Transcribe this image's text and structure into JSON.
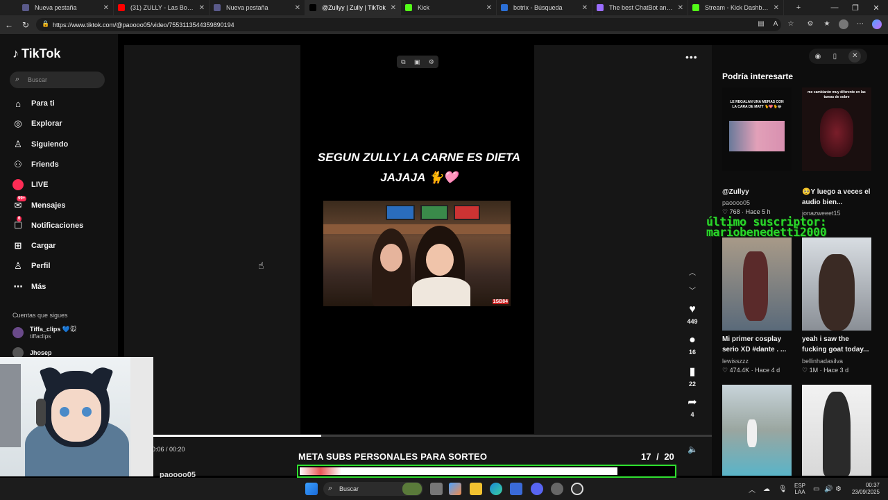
{
  "browser": {
    "tabs": [
      {
        "label": "Nueva pestaña",
        "color": "#5a5a8a",
        "active": false
      },
      {
        "label": "(31) ZULLY - Las Bonitas co",
        "color": "#ff0000",
        "active": false
      },
      {
        "label": "Nueva pestaña",
        "color": "#5a5a8a",
        "active": false
      },
      {
        "label": "@Zullyy | Zully | TikTok",
        "color": "#000000",
        "active": true
      },
      {
        "label": "Kick",
        "color": "#53fc18",
        "active": false
      },
      {
        "label": "botrix - Búsqueda",
        "color": "#2b6fd6",
        "active": false
      },
      {
        "label": "The best ChatBot and Widg",
        "color": "#9b6dff",
        "active": false
      },
      {
        "label": "Stream - Kick Dashboard",
        "color": "#53fc18",
        "active": false
      }
    ],
    "url": "https://www.tiktok.com/@paoooo05/video/7553113544359890194"
  },
  "sidebar": {
    "logo": "TikTok",
    "search_placeholder": "Buscar",
    "nav": [
      {
        "label": "Para ti",
        "icon": "home-icon",
        "glyph": "⌂"
      },
      {
        "label": "Explorar",
        "icon": "compass-icon",
        "glyph": "◎"
      },
      {
        "label": "Siguiendo",
        "icon": "person-icon",
        "glyph": "♙"
      },
      {
        "label": "Friends",
        "icon": "friends-icon",
        "glyph": "⚇"
      },
      {
        "label": "LIVE",
        "icon": "live-icon",
        "glyph": ""
      },
      {
        "label": "Mensajes",
        "icon": "message-icon",
        "glyph": "✉",
        "badge": "99+"
      },
      {
        "label": "Notificaciones",
        "icon": "inbox-icon",
        "glyph": "☐",
        "badge": "6"
      },
      {
        "label": "Cargar",
        "icon": "upload-icon",
        "glyph": "⊞"
      },
      {
        "label": "Perfil",
        "icon": "profile-icon",
        "glyph": "♙"
      },
      {
        "label": "Más",
        "icon": "more-icon",
        "glyph": "⋯"
      }
    ],
    "following_title": "Cuentas que sigues",
    "following": [
      {
        "name": "Tiffa_clips 💙🐭",
        "user": "tiffaclips"
      },
      {
        "name": "Jhosep",
        "user": ""
      }
    ]
  },
  "video": {
    "caption_line1": "SEGUN ZULLY LA CARNE ES DIETA",
    "caption_line2": "JAJAJA 🐈🩷",
    "watermark": "1SB84",
    "time": "0:06 / 00:20",
    "progress": 0.3,
    "author_peek": "paoooo05",
    "actions": {
      "likes": "449",
      "comments": "16",
      "saves": "22",
      "shares": "4"
    }
  },
  "stream_overlay": {
    "goal_title": "META SUBS PERSONALES PARA SORTEO",
    "goal_current": "17",
    "goal_total": "/ 20",
    "goal_fraction": 0.85,
    "last_sub_line1": "último suscriptor:",
    "last_sub_line2": "mariobenedetti2000"
  },
  "recommendations": {
    "title": "Podría interesarte",
    "cards": [
      {
        "title": "@Zullyy",
        "user": "paoooo05",
        "meta": "♡ 768 · Hace 5 h",
        "thumb_text": "LE REGALAN UNA MEFIAS CON LA CARA DE MATT 🐈💖🐈😂"
      },
      {
        "title": "🥺Y luego a veces el audio bien...",
        "user": "jonazweeet15",
        "meta": "",
        "thumb_text": "me cambiarón muy diferente en las tareas de sobre"
      },
      {
        "title": "Mi primer cosplay serio XD #dante . ...",
        "user": "lewisszzz",
        "meta": "♡ 474.4K · Hace 4 d",
        "thumb_text": ""
      },
      {
        "title": "yeah i saw the fucking goat today...",
        "user": "bellinhadasilva",
        "meta": "♡ 1M · Hace 3 d",
        "thumb_text": ""
      }
    ]
  },
  "taskbar": {
    "search": "Buscar",
    "lang_line1": "ESP",
    "lang_line2": "LAA",
    "clock_time": "00:37",
    "clock_date": "23/09/2025"
  }
}
